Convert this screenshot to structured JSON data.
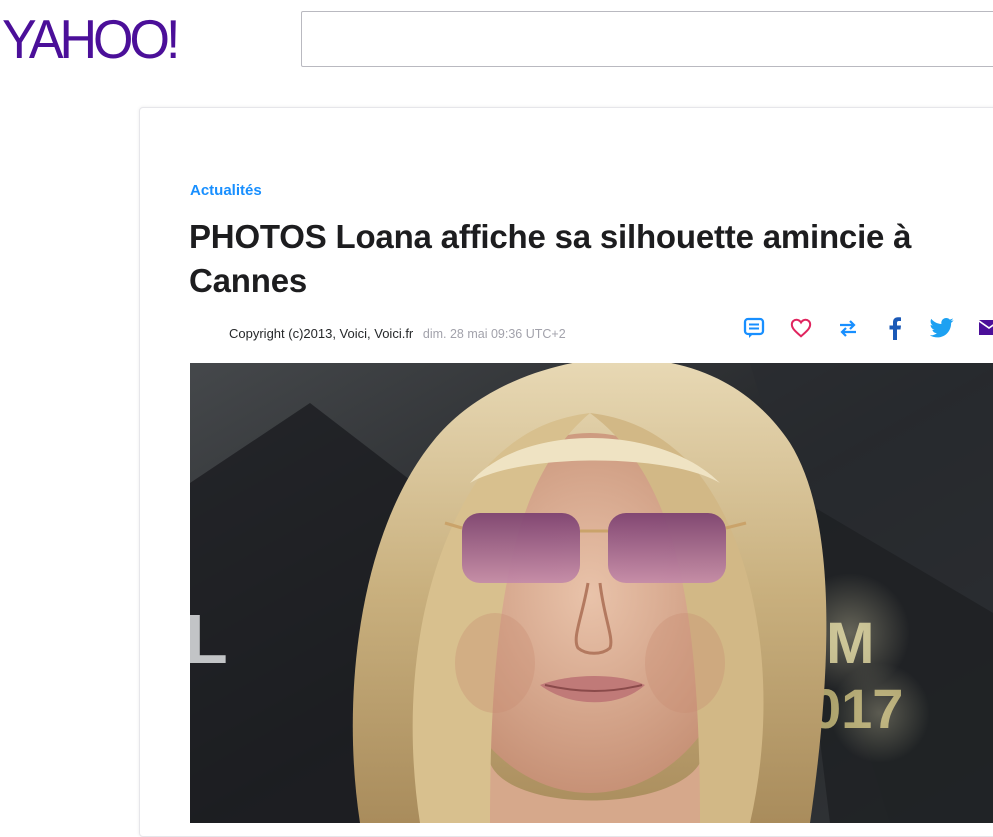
{
  "header": {
    "logo_text": "YAHOO!",
    "search_placeholder": ""
  },
  "article": {
    "category": "Actualités",
    "title": "PHOTOS Loana affiche sa silhouette amincie à Cannes",
    "byline": {
      "copyright": "Copyright (c)2013, Voici,",
      "source": "Voici.fr",
      "date": "dim. 28 mai 09:36 UTC+2"
    },
    "share_icons": [
      "comment-icon",
      "heart-icon",
      "retweet-icon",
      "facebook-icon",
      "twitter-icon",
      "mail-icon"
    ],
    "photo": {
      "subject": "woman-with-blonde-hair-and-pink-sunglasses",
      "backdrop_text": [
        "L",
        "IM",
        "017"
      ]
    }
  },
  "colors": {
    "brand": "#4b0f99",
    "accent": "#188fff",
    "heart": "#e0245e",
    "text": "#1d1d1f",
    "muted": "#a2a2ab",
    "mail": "#4b0f99"
  }
}
